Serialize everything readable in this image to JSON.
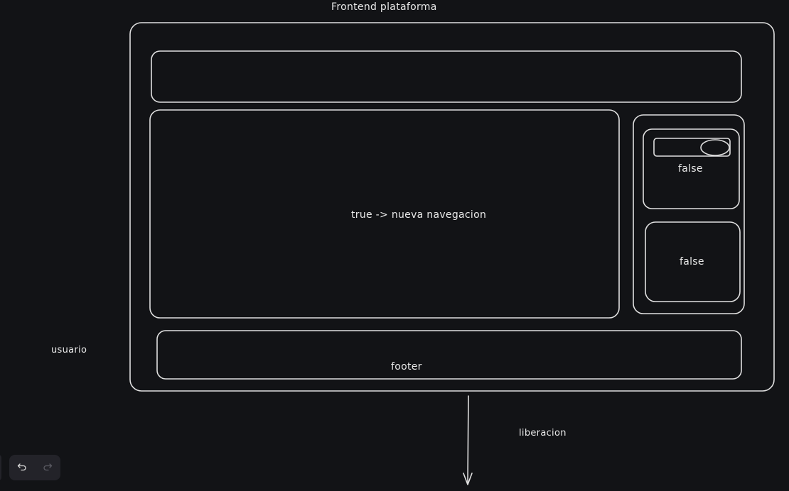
{
  "canvas": {
    "title_label": "Frontend plataforma",
    "actor_label": "usuario",
    "main_area_label": "true -> nueva navegacion",
    "sidebar_top_label": "false",
    "sidebar_bottom_label": "false",
    "footer_label": "footer",
    "arrow_label": "liberacion"
  },
  "toolbar": {
    "undo_icon": "undo-icon",
    "redo_icon": "redo-icon"
  },
  "colors": {
    "background": "#121316",
    "stroke": "#e0e0e0",
    "toolbar_bg": "#232329"
  }
}
